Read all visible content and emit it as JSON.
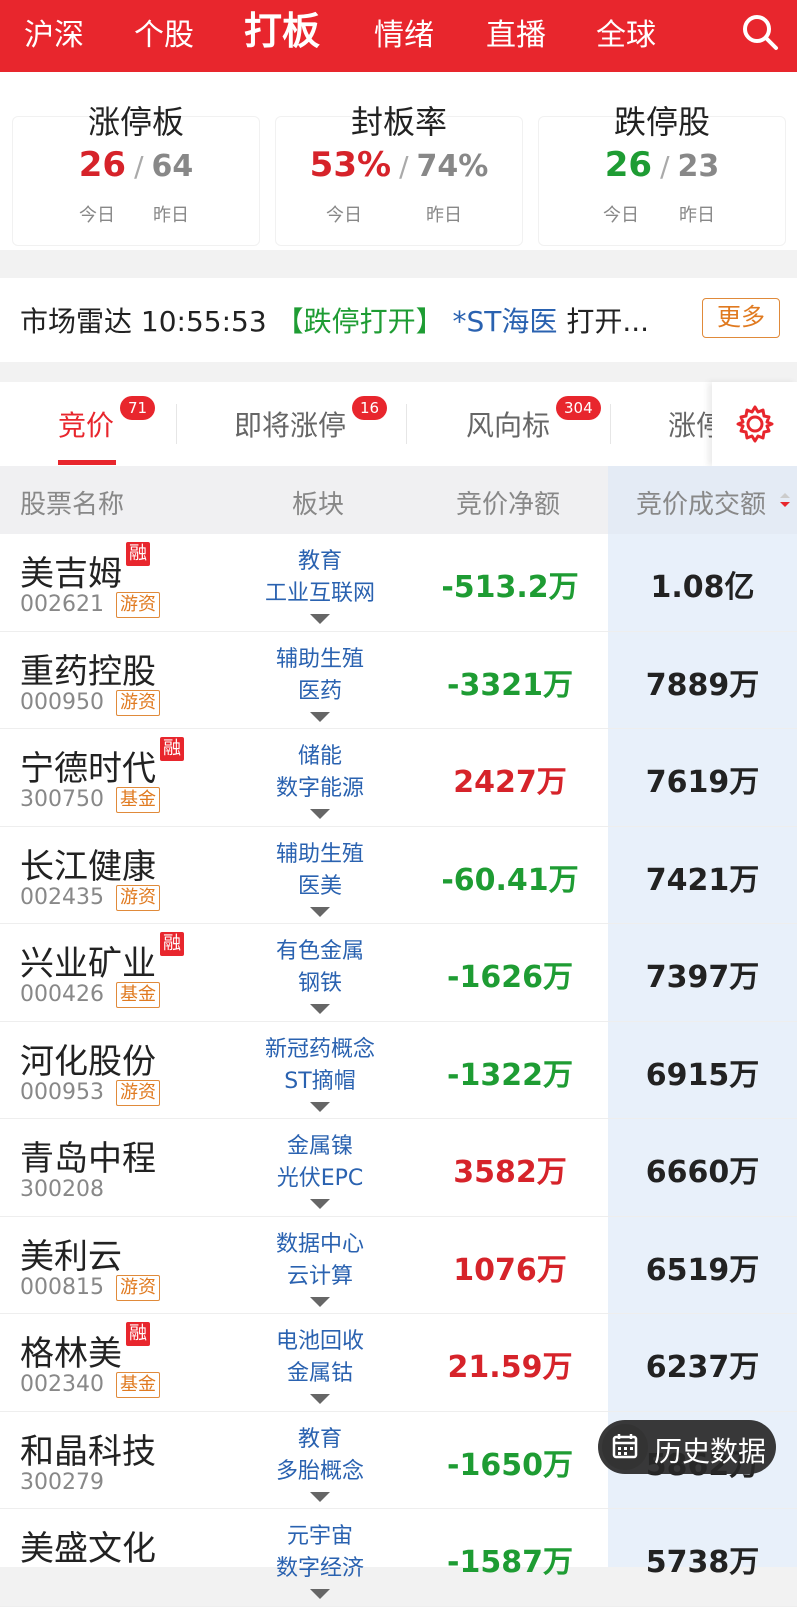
{
  "nav": {
    "tabs": [
      "沪深",
      "个股",
      "打板",
      "情绪",
      "直播",
      "全球"
    ],
    "active": "打板"
  },
  "stats": [
    {
      "title": "涨停板",
      "today": "26",
      "yesterday": "64",
      "today_label": "今日",
      "yesterday_label": "昨日",
      "color": "red"
    },
    {
      "title": "封板率",
      "today": "53%",
      "yesterday": "74%",
      "today_label": "今日",
      "yesterday_label": "昨日",
      "color": "red"
    },
    {
      "title": "跌停股",
      "today": "26",
      "yesterday": "23",
      "today_label": "今日",
      "yesterday_label": "昨日",
      "color": "green"
    }
  ],
  "radar": {
    "label": "市场雷达",
    "time": "10:55:53",
    "tag": "【跌停打开】",
    "stock": "*ST海医",
    "text": "打开...",
    "more": "更多"
  },
  "tabs": [
    {
      "label": "竞价",
      "badge": "71",
      "active": true
    },
    {
      "label": "即将涨停",
      "badge": "16",
      "active": false
    },
    {
      "label": "风向标",
      "badge": "304",
      "active": false
    },
    {
      "label": "涨停",
      "badge": "",
      "active": false
    }
  ],
  "table": {
    "headers": [
      "股票名称",
      "板块",
      "竞价净额",
      "竞价成交额"
    ],
    "rows": [
      {
        "name": "美吉姆",
        "code": "002621",
        "rong": true,
        "tag": "游资",
        "sector1": "教育",
        "sector2": "工业互联网",
        "net": "-513.2万",
        "net_dir": "down",
        "amount": "1.08亿"
      },
      {
        "name": "重药控股",
        "code": "000950",
        "rong": false,
        "tag": "游资",
        "sector1": "辅助生殖",
        "sector2": "医药",
        "net": "-3321万",
        "net_dir": "down",
        "amount": "7889万"
      },
      {
        "name": "宁德时代",
        "code": "300750",
        "rong": true,
        "tag": "基金",
        "sector1": "储能",
        "sector2": "数字能源",
        "net": "2427万",
        "net_dir": "up",
        "amount": "7619万"
      },
      {
        "name": "长江健康",
        "code": "002435",
        "rong": false,
        "tag": "游资",
        "sector1": "辅助生殖",
        "sector2": "医美",
        "net": "-60.41万",
        "net_dir": "down",
        "amount": "7421万"
      },
      {
        "name": "兴业矿业",
        "code": "000426",
        "rong": true,
        "tag": "基金",
        "sector1": "有色金属",
        "sector2": "钢铁",
        "net": "-1626万",
        "net_dir": "down",
        "amount": "7397万"
      },
      {
        "name": "河化股份",
        "code": "000953",
        "rong": false,
        "tag": "游资",
        "sector1": "新冠药概念",
        "sector2": "ST摘帽",
        "net": "-1322万",
        "net_dir": "down",
        "amount": "6915万"
      },
      {
        "name": "青岛中程",
        "code": "300208",
        "rong": false,
        "tag": "",
        "sector1": "金属镍",
        "sector2": "光伏EPC",
        "net": "3582万",
        "net_dir": "up",
        "amount": "6660万"
      },
      {
        "name": "美利云",
        "code": "000815",
        "rong": false,
        "tag": "游资",
        "sector1": "数据中心",
        "sector2": "云计算",
        "net": "1076万",
        "net_dir": "up",
        "amount": "6519万"
      },
      {
        "name": "格林美",
        "code": "002340",
        "rong": true,
        "tag": "基金",
        "sector1": "电池回收",
        "sector2": "金属钴",
        "net": "21.59万",
        "net_dir": "up",
        "amount": "6237万"
      },
      {
        "name": "和晶科技",
        "code": "300279",
        "rong": false,
        "tag": "",
        "sector1": "教育",
        "sector2": "多胎概念",
        "net": "-1650万",
        "net_dir": "down",
        "amount": "5862万"
      },
      {
        "name": "美盛文化",
        "code": "",
        "rong": false,
        "tag": "",
        "sector1": "元宇宙",
        "sector2": "数字经济",
        "net": "-1587万",
        "net_dir": "down",
        "amount": "5738万"
      }
    ]
  },
  "rong_label": "融",
  "history_button": "历史数据",
  "colors": {
    "brand_red": "#e8262d",
    "up_red": "#d6232a",
    "down_green": "#1e9c33",
    "sector_blue": "#2a62b0",
    "tag_orange": "#e07a20"
  }
}
